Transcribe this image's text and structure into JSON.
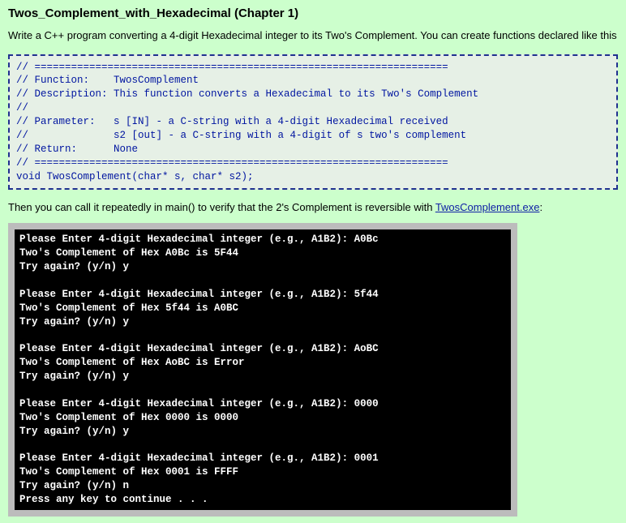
{
  "title": "Twos_Complement_with_Hexadecimal (Chapter 1)",
  "intro": "Write a C++ program converting a 4-digit Hexadecimal integer to its Two's Complement. You can create functions declared like this",
  "code_block": "// ====================================================================\n// Function:    TwosComplement\n// Description: This function converts a Hexadecimal to its Two's Complement\n//\n// Parameter:   s [IN] - a C-string with a 4-digit Hexadecimal received\n//              s2 [out] - a C-string with a 4-digit of s two's complement\n// Return:      None\n// ====================================================================\nvoid TwosComplement(char* s, char* s2);",
  "then_text_before": "Then you can call it repeatedly in main() to verify that the 2's Complement is reversible with ",
  "link_text": "TwosComplement.exe",
  "then_text_after": ":",
  "terminal_text": "Please Enter 4-digit Hexadecimal integer (e.g., A1B2): A0Bc\nTwo's Complement of Hex A0Bc is 5F44\nTry again? (y/n) y\n\nPlease Enter 4-digit Hexadecimal integer (e.g., A1B2): 5f44\nTwo's Complement of Hex 5f44 is A0BC\nTry again? (y/n) y\n\nPlease Enter 4-digit Hexadecimal integer (e.g., A1B2): AoBC\nTwo's Complement of Hex AoBC is Error\nTry again? (y/n) y\n\nPlease Enter 4-digit Hexadecimal integer (e.g., A1B2): 0000\nTwo's Complement of Hex 0000 is 0000\nTry again? (y/n) y\n\nPlease Enter 4-digit Hexadecimal integer (e.g., A1B2): 0001\nTwo's Complement of Hex 0001 is FFFF\nTry again? (y/n) n\nPress any key to continue . . ."
}
